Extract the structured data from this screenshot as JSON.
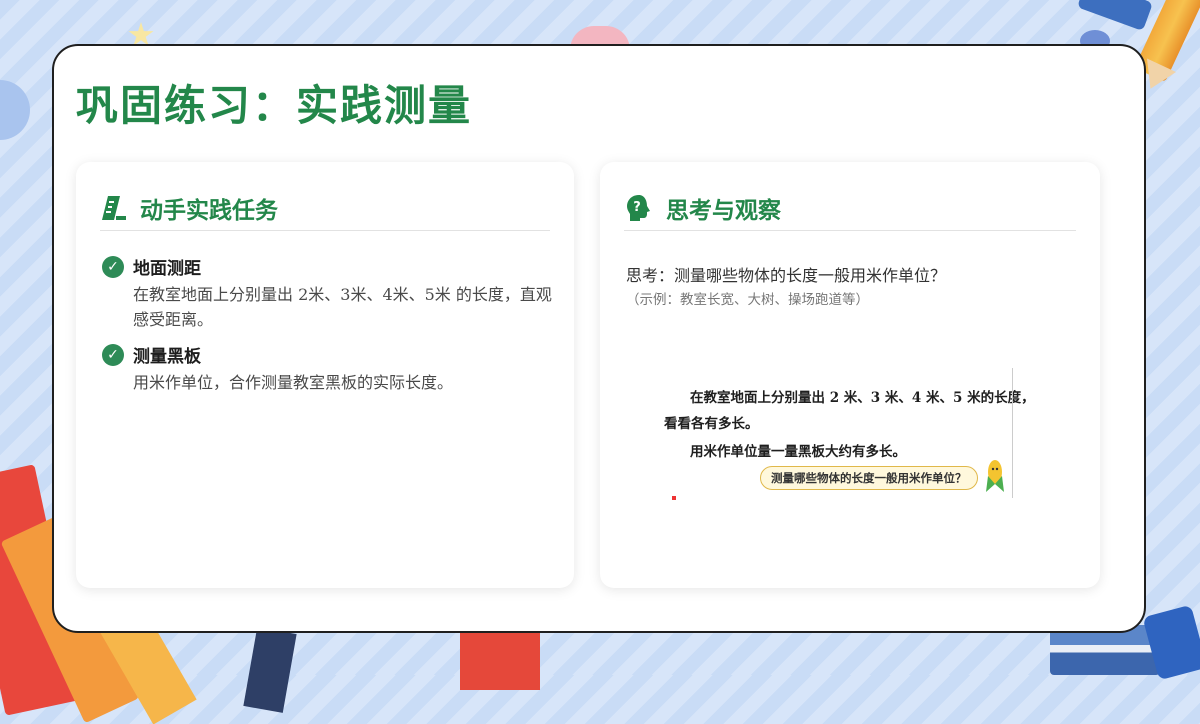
{
  "page": {
    "title": "巩固练习：实践测量"
  },
  "left_panel": {
    "title": "动手实践任务",
    "icon": "ruler-icon",
    "tasks": [
      {
        "title": "地面测距",
        "description": "在教室地面上分别量出 2米、3米、4米、5米 的长度，直观感受距离。"
      },
      {
        "title": "测量黑板",
        "description": "用米作单位，合作测量教室黑板的实际长度。"
      }
    ]
  },
  "right_panel": {
    "title": "思考与观察",
    "icon": "question-head-icon",
    "question": "思考：测量哪些物体的长度一般用米作单位？",
    "example": "（示例：教室长宽、大树、操场跑道等）",
    "textbook": {
      "line1": "在教室地面上分别量出 2 米、3 米、4 米、5 米的长度，",
      "line2": "看看各有多长。",
      "line3": "用米作单位量一量黑板大约有多长。",
      "bubble": "测量哪些物体的长度一般用米作单位？"
    }
  },
  "colors": {
    "accent_green": "#23874a",
    "check_green": "#2e8b57"
  }
}
